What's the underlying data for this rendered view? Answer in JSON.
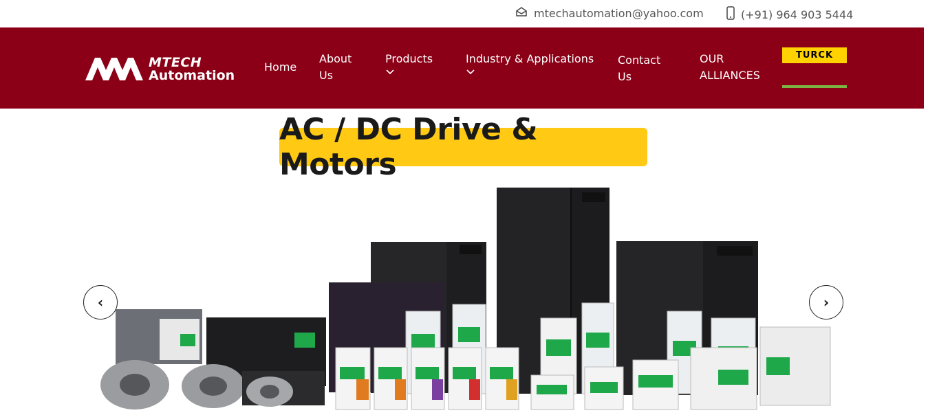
{
  "topbar": {
    "email": "mtechautomation@yahoo.com",
    "phone": "(+91) 964 903 5444"
  },
  "brand": {
    "line1": "MTECH",
    "line2": "Automation"
  },
  "nav": {
    "home": "Home",
    "about": "About Us",
    "products": "Products",
    "industry": "Industry & Applications",
    "contact": "Contact Us",
    "alliances": "OUR ALLIANCES"
  },
  "partner": {
    "turck": "TURCK"
  },
  "banner": {
    "title": "AC / DC Drive & Motors",
    "prev": "‹",
    "next": "›"
  },
  "colors": {
    "header_bg": "#8b0017",
    "banner_title_bg": "#ffc914",
    "turck_bg": "#ffd200"
  }
}
